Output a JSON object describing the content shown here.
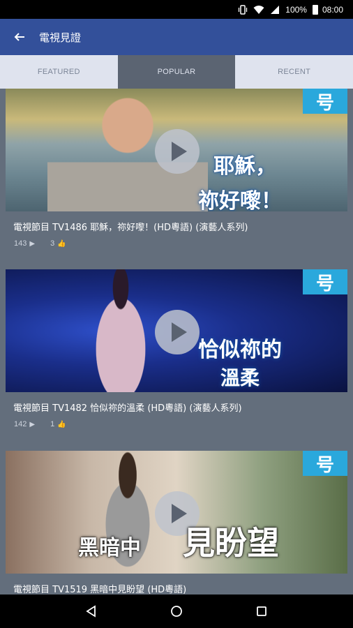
{
  "status_bar": {
    "battery": "100%",
    "time": "08:00"
  },
  "app_bar": {
    "title": "電視見證"
  },
  "tabs": [
    {
      "label": "FEATURED"
    },
    {
      "label": "POPULAR"
    },
    {
      "label": "RECENT"
    }
  ],
  "videos": [
    {
      "title": "電視節目 TV1486 耶穌，祢好嚟！(HD粵語) (演藝人系列)",
      "views": "143",
      "likes": "3",
      "caption_line1": "耶穌，",
      "caption_line2": "祢好嚟！"
    },
    {
      "title": "電視節目 TV1482 恰似祢的溫柔 (HD粵語) (演藝人系列)",
      "views": "142",
      "likes": "1",
      "caption_line1": "恰似祢的",
      "caption_line2": "溫柔"
    },
    {
      "title": "電視節目 TV1519 黑暗中見盼望 (HD粵語)",
      "caption_line1": "黑暗中",
      "caption_line2": "見盼望"
    }
  ],
  "thumb_logo_text": "号",
  "colors": {
    "app_bar": "#33509a",
    "background": "#636e7c",
    "logo": "#2aa8dc"
  }
}
